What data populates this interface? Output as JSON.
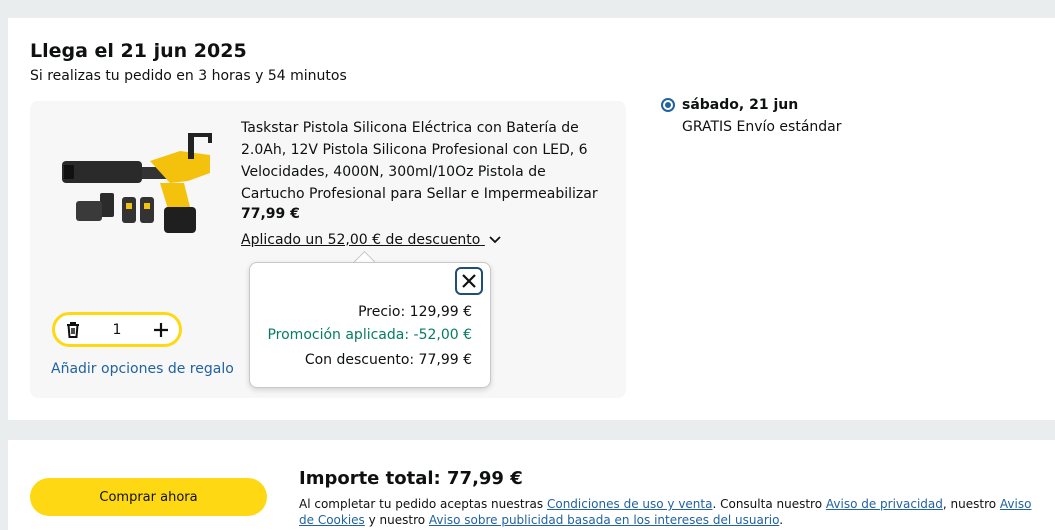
{
  "delivery": {
    "title": "Llega el 21 jun 2025",
    "subtitle": "Si realizas tu pedido en 3 horas y 54 minutos"
  },
  "product": {
    "title": "Taskstar Pistola Silicona Eléctrica con Batería de 2.0Ah, 12V Pistola Silicona Profesional con LED, 6 Velocidades, 4000N, 300ml/10Oz Pistola de Cartucho Profesional para Sellar e Impermeabilizar",
    "price": "77,99 €",
    "discount_link": "Aplicado un 52,00 € de descuento",
    "image_icon": "caulking-gun-product-image"
  },
  "quantity": {
    "value": "1",
    "delete_icon": "trash-icon",
    "plus_icon": "plus-icon"
  },
  "gift_link": "Añadir opciones de regalo",
  "popover": {
    "price_line": "Precio: 129,99 €",
    "promo_line": "Promoción aplicada: -52,00 €",
    "discounted_line": "Con descuento: 77,99 €",
    "close_icon": "close-icon"
  },
  "shipping": {
    "date": "sábado, 21 jun",
    "type": "GRATIS Envío estándar"
  },
  "checkout": {
    "buy_label": "Comprar ahora",
    "total": "Importe total: 77,99 €",
    "legal_1": "Al completar tu pedido aceptas nuestras ",
    "link_terms": "Condiciones de uso y venta",
    "legal_2": ". Consulta nuestro ",
    "link_privacy": "Aviso de privacidad",
    "legal_3": ", nuestro ",
    "link_cookies": "Aviso de Cookies",
    "legal_4": " y nuestro ",
    "link_ads": "Aviso sobre publicidad basada en los intereses del usuario",
    "legal_5": "."
  },
  "colors": {
    "accent_yellow": "#ffd814",
    "link_blue": "#2162a1",
    "promo_green": "#067d62",
    "background": "#eaeded"
  }
}
